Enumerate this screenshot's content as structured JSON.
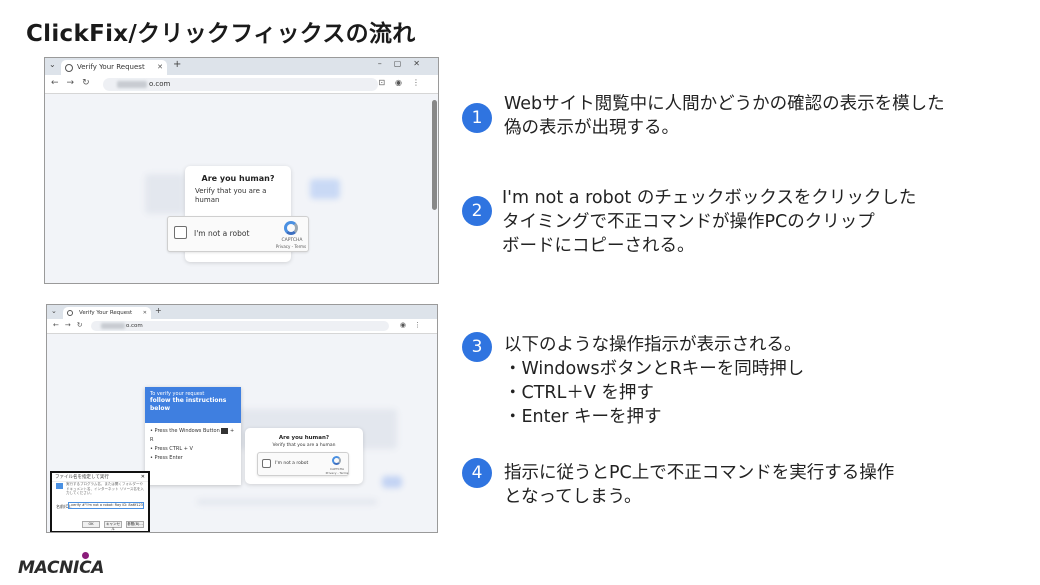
{
  "title": "ClickFix/クリックフィックスの流れ",
  "browser": {
    "tab_title": "Verify Your Request",
    "url_suffix": "o.com",
    "url_suffix_2": "o.com"
  },
  "captcha1": {
    "heading": "Are you human?",
    "subtext": "Verify that you are a human",
    "checkbox_label": "I'm not a robot",
    "brand": "CAPTCHA",
    "links": "Privacy - Terms"
  },
  "instructions_panel": {
    "line1": "To verify your request",
    "line2": "follow the instructions below",
    "items": [
      "Press the Windows Button",
      "+ R",
      "Press CTRL + V",
      "Press Enter"
    ]
  },
  "captcha2": {
    "heading": "Are you human?",
    "subtext": "Verify that you are a human",
    "checkbox_label": "I'm not a robot",
    "brand": "CAPTCHA",
    "links": "Privacy - Terms"
  },
  "run_dialog": {
    "title": "ファイル名を指定して実行",
    "desc": "実行するプログラム名、または開くフォルダーやドキュメント名、インターネット リソース名を入力してください。",
    "field_label": "名前(O):",
    "field_value": "verify #\"I'm not a robot: Ray ID: 8a6f1234ab5678\"",
    "buttons": [
      "OK",
      "キャンセル",
      "参照(B)..."
    ]
  },
  "steps": [
    {
      "num": "1",
      "lines": [
        "Webサイト閲覧中に人間かどうかの確認の表示を模した",
        "偽の表示が出現する。"
      ]
    },
    {
      "num": "2",
      "lines": [
        "I'm not a robot のチェックボックスをクリックした",
        "タイミングで不正コマンドが操作PCのクリップ",
        "ボードにコピーされる。"
      ]
    },
    {
      "num": "3",
      "lines": [
        "以下のような操作指示が表示される。",
        "・WindowsボタンとRキーを同時押し",
        "・CTRL＋V を押す",
        "・Enter キーを押す"
      ]
    },
    {
      "num": "4",
      "lines": [
        "指示に従うとPC上で不正コマンドを実行する操作",
        "となってしまう。"
      ]
    }
  ],
  "logo": "MACNICA",
  "colors": {
    "accent": "#2f74e0",
    "instruction_blue": "#3f7fe0",
    "logo_dot": "#8a1c7a"
  }
}
